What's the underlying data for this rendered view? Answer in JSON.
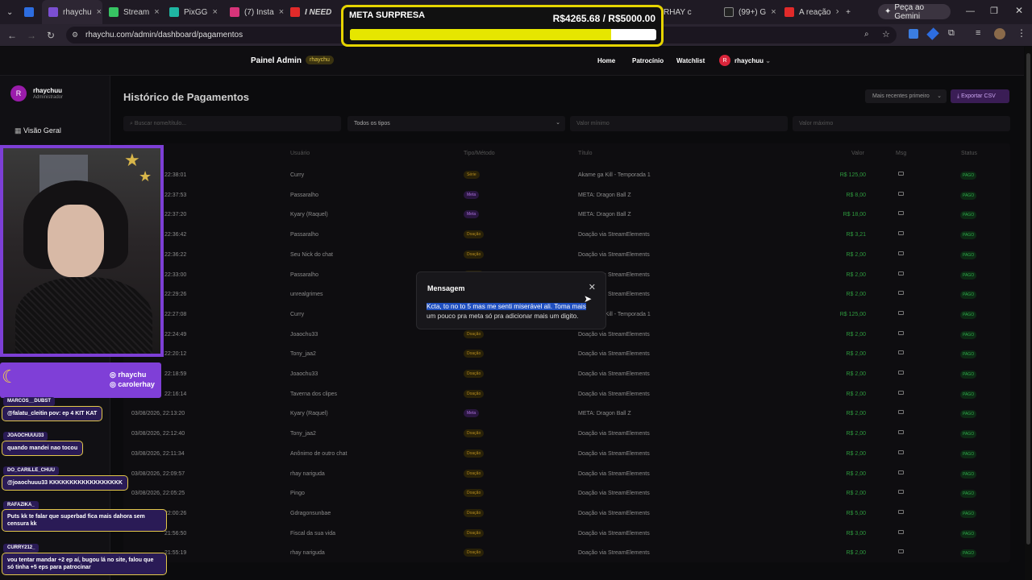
{
  "browser": {
    "tabs": [
      {
        "label": "rhaychu",
        "color": "#7b4fd1"
      },
      {
        "label": "Stream",
        "color": "#37c463"
      },
      {
        "label": "PixGG",
        "color": "#1fb6a3"
      },
      {
        "label": "(7) Insta",
        "color": "#d7347a"
      },
      {
        "label": "I NEED",
        "color": "#e12a2a"
      },
      {
        "label": "RHAY c",
        "color": "#e12a2a"
      },
      {
        "label": "(99+) G",
        "color": "#222222"
      },
      {
        "label": "A reação",
        "color": "#e12a2a"
      }
    ],
    "url": "rhaychu.com/admin/dashboard/pagamentos",
    "gemini_label": "Peça ao Gemini"
  },
  "meta_overlay": {
    "title": "META SURPRESA",
    "amount": "R$4265.68 / R$5000.00",
    "progress_fraction": 0.853
  },
  "header": {
    "brand": "Painel Admin",
    "badge": "rhaychu",
    "nav": [
      "Home",
      "Patrocínio",
      "Watchlist"
    ],
    "user_initial": "R",
    "user_name": "rhaychuu"
  },
  "sidebar": {
    "avatar_initial": "R",
    "name": "rhaychuu",
    "role": "Administrador",
    "items": [
      {
        "label": "Visão Geral"
      }
    ]
  },
  "main": {
    "title": "Histórico de Pagamentos",
    "sort_value": "Mais recentes primeiro",
    "export_label": "Exportar CSV",
    "filters": {
      "search_placeholder": "Buscar nome/título...",
      "type_value": "Todos os tipos",
      "min_placeholder": "Valor mínimo",
      "max_placeholder": "Valor máximo"
    },
    "columns": [
      "Usuário",
      "Tipo/Método",
      "Título",
      "Valor",
      "Msg",
      "Status"
    ],
    "rows": [
      {
        "date": "22:38:01",
        "user": "Curry",
        "type": "Série",
        "kind": "serie",
        "title": "Akame ga Kill - Temporada 1",
        "value": "R$ 125,00",
        "status": "PAGO"
      },
      {
        "date": "22:37:53",
        "user": "Passaralho",
        "type": "Meta",
        "kind": "meta",
        "title": "META: Dragon Ball Z",
        "value": "R$ 8,00",
        "status": "PAGO"
      },
      {
        "date": "22:37:20",
        "user": "Kyary (Raquel)",
        "type": "Meta",
        "kind": "meta",
        "title": "META: Dragon Ball Z",
        "value": "R$ 18,00",
        "status": "PAGO"
      },
      {
        "date": "22:36:42",
        "user": "Passaralho",
        "type": "Doação",
        "kind": "doacao",
        "title": "Doação via StreamElements",
        "value": "R$ 3,21",
        "status": "PAGO"
      },
      {
        "date": "22:36:22",
        "user": "Seu Nick do chat",
        "type": "Doação",
        "kind": "doacao",
        "title": "Doação via StreamElements",
        "value": "R$ 2,00",
        "status": "PAGO"
      },
      {
        "date": "22:33:00",
        "user": "Passaralho",
        "type": "Doação",
        "kind": "doacao",
        "title": "Doação via StreamElements",
        "value": "R$ 2,00",
        "status": "PAGO"
      },
      {
        "date": "22:29:26",
        "user": "unrealgrimes",
        "type": "Doação",
        "kind": "doacao",
        "title": "Doação via StreamElements",
        "value": "R$ 2,00",
        "status": "PAGO"
      },
      {
        "date": "22:27:08",
        "user": "Curry",
        "type": "Série",
        "kind": "serie",
        "title": "Akame ga Kill - Temporada 1",
        "value": "R$ 125,00",
        "status": "PAGO"
      },
      {
        "date": "22:24:49",
        "user": "Joaochu33",
        "type": "Doação",
        "kind": "doacao",
        "title": "Doação via StreamElements",
        "value": "R$ 2,00",
        "status": "PAGO"
      },
      {
        "date": "22:20:12",
        "user": "Tony_jaa2",
        "type": "Doação",
        "kind": "doacao",
        "title": "Doação via StreamElements",
        "value": "R$ 2,00",
        "status": "PAGO"
      },
      {
        "date": "22:18:59",
        "user": "Joaochu33",
        "type": "Doação",
        "kind": "doacao",
        "title": "Doação via StreamElements",
        "value": "R$ 2,00",
        "status": "PAGO"
      },
      {
        "date": "22:16:14",
        "user": "Taverna dos clipes",
        "type": "Doação",
        "kind": "doacao",
        "title": "Doação via StreamElements",
        "value": "R$ 2,00",
        "status": "PAGO"
      },
      {
        "date": "03/08/2026, 22:13:20",
        "user": "Kyary (Raquel)",
        "type": "Meta",
        "kind": "meta",
        "title": "META: Dragon Ball Z",
        "value": "R$ 2,00",
        "status": "PAGO"
      },
      {
        "date": "03/08/2026, 22:12:40",
        "user": "Tony_jaa2",
        "type": "Doação",
        "kind": "doacao",
        "title": "Doação via StreamElements",
        "value": "R$ 2,00",
        "status": "PAGO"
      },
      {
        "date": "03/08/2026, 22:11:34",
        "user": "Anônimo de outro chat",
        "type": "Doação",
        "kind": "doacao",
        "title": "Doação via StreamElements",
        "value": "R$ 2,00",
        "status": "PAGO"
      },
      {
        "date": "03/08/2026, 22:09:57",
        "user": "rhay nariguda",
        "type": "Doação",
        "kind": "doacao",
        "title": "Doação via StreamElements",
        "value": "R$ 2,00",
        "status": "PAGO"
      },
      {
        "date": "03/08/2026, 22:05:25",
        "user": "Pingo",
        "type": "Doação",
        "kind": "doacao",
        "title": "Doação via StreamElements",
        "value": "R$ 2,00",
        "status": "PAGO"
      },
      {
        "date": "22:00:26",
        "user": "Gdragonsunbae",
        "type": "Doação",
        "kind": "doacao",
        "title": "Doação via StreamElements",
        "value": "R$ 5,00",
        "status": "PAGO"
      },
      {
        "date": "21:56:50",
        "user": "Fiscal da sua vida",
        "type": "Doação",
        "kind": "doacao",
        "title": "Doação via StreamElements",
        "value": "R$ 3,00",
        "status": "PAGO"
      },
      {
        "date": "21:55:19",
        "user": "rhay nariguda",
        "type": "Doação",
        "kind": "doacao",
        "title": "Doação via StreamElements",
        "value": "R$ 2,00",
        "status": "PAGO"
      }
    ]
  },
  "modal": {
    "title": "Mensagem",
    "highlight": "Kcta, to no to 5 mas me senti miserável ali.  Toma mais",
    "rest": " um pouco pra meta só pra adicionar mais um digito."
  },
  "overlay_handles": [
    "rhaychu",
    "carolerhay"
  ],
  "chat": [
    {
      "user": "MARCOS__DUBST",
      "msg": "@falatu_cleitin pov: ep 4 KIT KAT"
    },
    {
      "user": "JOAOCHUUU33",
      "msg": "quando mandei nao tocou"
    },
    {
      "user": "DO_CARILLE_CHUU",
      "msg": "@joaochuuu33 KKKKKKKKKKKKKKKKKK"
    },
    {
      "user": "RAFAZIKA_",
      "msg": "Puts kk te falar que superbad fica mais dahora sem censura kk"
    },
    {
      "user": "CURRY212_",
      "msg": "vou tentar mandar +2 ep aí, bugou lá no site, falou que só tinha +5 eps para patrocinar"
    }
  ]
}
